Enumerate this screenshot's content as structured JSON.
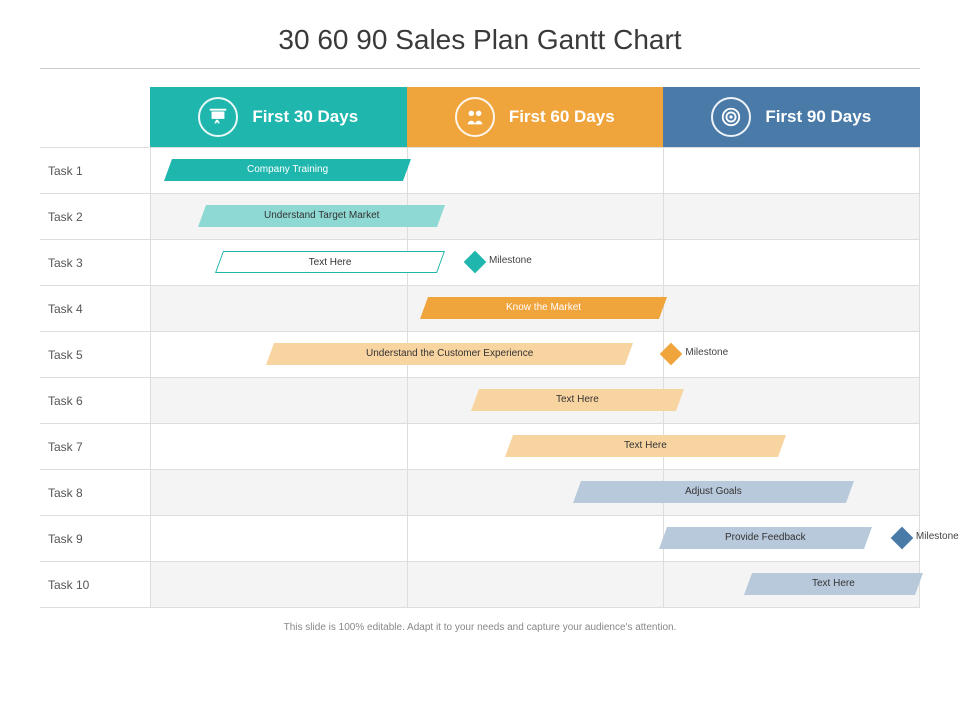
{
  "title": "30 60 90 Sales Plan Gantt Chart",
  "caption": "This slide is 100% editable. Adapt it to your needs and capture your audience's attention.",
  "columns": [
    {
      "label": "First 30 Days",
      "color": "teal",
      "icon": "presentation"
    },
    {
      "label": "First 60 Days",
      "color": "orange",
      "icon": "handshake"
    },
    {
      "label": "First 90 Days",
      "color": "blue",
      "icon": "target"
    }
  ],
  "milestone_label": "Milestone",
  "chart_data": {
    "type": "gantt",
    "periods": [
      "First 30 Days",
      "First 60 Days",
      "First 90 Days"
    ],
    "rows": [
      {
        "task": "Task 1",
        "bar": {
          "label": "Company Training",
          "start": 2,
          "end": 30,
          "color": "teal",
          "shade": "dark"
        }
      },
      {
        "task": "Task 2",
        "bar": {
          "label": "Understand Target Market",
          "start": 6,
          "end": 34,
          "color": "teal",
          "shade": "light"
        }
      },
      {
        "task": "Task 3",
        "bar": {
          "label": "Text Here",
          "start": 8,
          "end": 34,
          "color": "teal",
          "shade": "outline"
        },
        "milestone": {
          "at": 38,
          "color": "teal"
        }
      },
      {
        "task": "Task 4",
        "bar": {
          "label": "Know the Market",
          "start": 32,
          "end": 60,
          "color": "orange",
          "shade": "dark"
        }
      },
      {
        "task": "Task 5",
        "bar": {
          "label": "Understand the Customer Experience",
          "start": 14,
          "end": 56,
          "color": "orange",
          "shade": "light"
        },
        "milestone": {
          "at": 61,
          "color": "orange"
        }
      },
      {
        "task": "Task 6",
        "bar": {
          "label": "Text Here",
          "start": 38,
          "end": 62,
          "color": "orange",
          "shade": "light"
        }
      },
      {
        "task": "Task 7",
        "bar": {
          "label": "Text Here",
          "start": 42,
          "end": 74,
          "color": "orange",
          "shade": "light"
        }
      },
      {
        "task": "Task 8",
        "bar": {
          "label": "Adjust Goals",
          "start": 50,
          "end": 82,
          "color": "blue",
          "shade": "light"
        }
      },
      {
        "task": "Task 9",
        "bar": {
          "label": "Provide Feedback",
          "start": 60,
          "end": 84,
          "color": "blue",
          "shade": "light"
        },
        "milestone": {
          "at": 88,
          "color": "blue"
        }
      },
      {
        "task": "Task 10",
        "bar": {
          "label": "Text Here",
          "start": 70,
          "end": 90,
          "color": "blue",
          "shade": "light"
        }
      }
    ],
    "xrange": [
      0,
      90
    ]
  }
}
